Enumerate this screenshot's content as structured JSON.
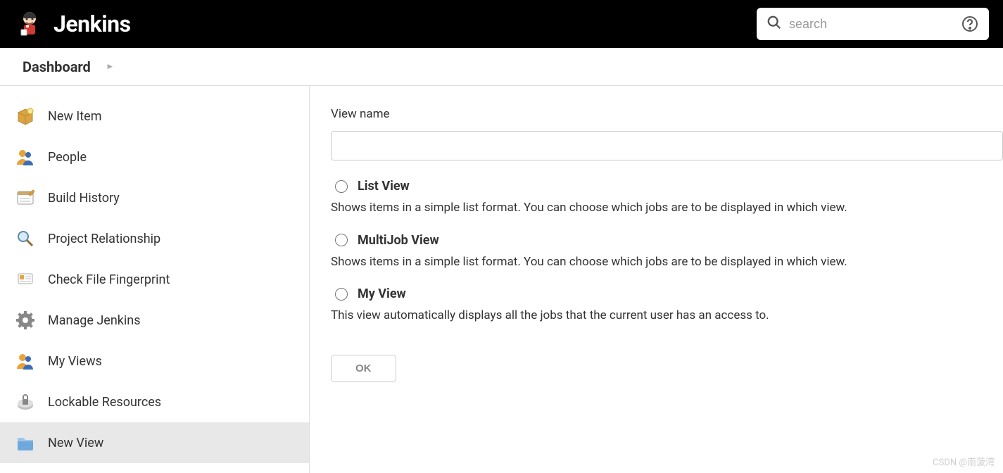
{
  "header": {
    "logo_text": "Jenkins",
    "search_placeholder": "search"
  },
  "breadcrumb": {
    "item": "Dashboard"
  },
  "sidebar": {
    "items": [
      {
        "label": "New Item",
        "key": "new-item"
      },
      {
        "label": "People",
        "key": "people"
      },
      {
        "label": "Build History",
        "key": "build-history"
      },
      {
        "label": "Project Relationship",
        "key": "project-relationship"
      },
      {
        "label": "Check File Fingerprint",
        "key": "check-file-fingerprint"
      },
      {
        "label": "Manage Jenkins",
        "key": "manage-jenkins"
      },
      {
        "label": "My Views",
        "key": "my-views"
      },
      {
        "label": "Lockable Resources",
        "key": "lockable-resources"
      },
      {
        "label": "New View",
        "key": "new-view"
      }
    ]
  },
  "form": {
    "view_name_label": "View name",
    "view_name_value": "",
    "options": [
      {
        "label": "List View",
        "desc": "Shows items in a simple list format. You can choose which jobs are to be displayed in which view."
      },
      {
        "label": "MultiJob View",
        "desc": "Shows items in a simple list format. You can choose which jobs are to be displayed in which view."
      },
      {
        "label": "My View",
        "desc": "This view automatically displays all the jobs that the current user has an access to."
      }
    ],
    "ok_label": "OK"
  },
  "watermark": "CSDN @南菠湾"
}
